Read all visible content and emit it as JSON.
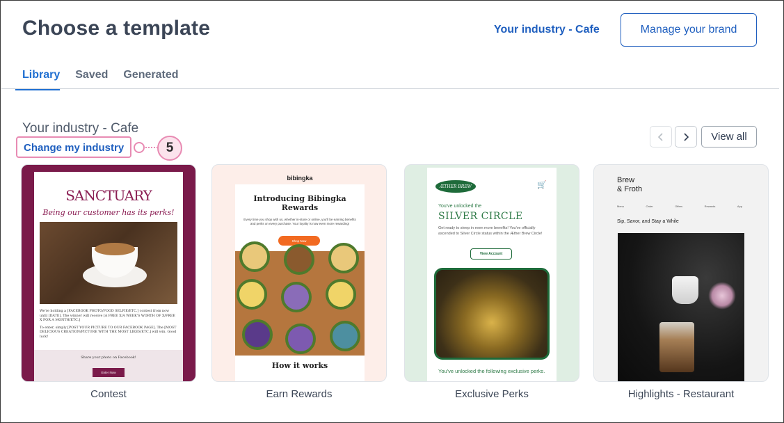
{
  "header": {
    "title": "Choose a template",
    "industry_link": "Your industry - Cafe",
    "manage_brand": "Manage your brand"
  },
  "tabs": [
    {
      "label": "Library",
      "active": true
    },
    {
      "label": "Saved",
      "active": false
    },
    {
      "label": "Generated",
      "active": false
    }
  ],
  "section": {
    "title": "Your industry - Cafe",
    "change_link": "Change my industry",
    "callout_number": "5",
    "view_all": "View all",
    "prev_icon": "chevron-left-icon",
    "next_icon": "chevron-right-icon"
  },
  "templates": [
    {
      "label": "Contest",
      "preview": {
        "logo": "SANCTUARY",
        "tagline": "Being our customer has its perks!",
        "body1": "We're holding a [FACEBOOK PHOTO/FOOD SELFIE/ETC.] contest from now until [DATE]. The winner will receive [A FREE X/A WEEK'S WORTH OF X/FREE X FOR A MONTH/ETC.]",
        "body2": "To enter, simply [POST YOUR PICTURE TO OUR FACEBOOK PAGE]. The [MOST DELICIOUS CREATION/PICTURE WITH THE MOST LIKES/ETC.] will win. Good luck!",
        "share": "Share your photo on Facebook!",
        "button": "Enter Now"
      }
    },
    {
      "label": "Earn Rewards",
      "preview": {
        "brand": "bibingka",
        "heading": "Introducing Bibingka Rewards",
        "copy": "Every time you shop with us, whether in-store or online, you'll be earning benefits and perks on every purchase. Your loyalty is now even more rewarding!",
        "button": "Shop Now",
        "footer": "How it works"
      }
    },
    {
      "label": "Exclusive Perks",
      "preview": {
        "logo": "ÆTHER BREW",
        "unlocked": "You've unlocked the",
        "headline": "SILVER CIRCLE",
        "copy": "Get ready to steep in even more benefits! You've officially ascended to Silver Circle status within the Æther Brew Circle!",
        "button": "View Account",
        "perks": "You've unlocked the following exclusive perks."
      }
    },
    {
      "label": "Highlights - Restaurant",
      "preview": {
        "brand_line1": "Brew",
        "brand_line2": "& Froth",
        "menu": [
          "Menu",
          "Order",
          "Offers",
          "Rewards",
          "App"
        ],
        "tagline": "Sip, Savor, and Stay a While"
      }
    }
  ],
  "colors": {
    "accent": "#1f5fbf",
    "callout": "#e88bb3",
    "contest_maroon": "#7a1a4a",
    "perks_green": "#1e6b3a",
    "rewards_orange": "#f26a21"
  }
}
